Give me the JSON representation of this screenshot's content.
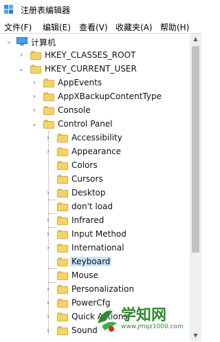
{
  "window": {
    "title": "注册表编辑器"
  },
  "menu": [
    {
      "label": "文件(F)"
    },
    {
      "label": "编辑(E)"
    },
    {
      "label": "查看(V)"
    },
    {
      "label": "收藏夹(A)"
    },
    {
      "label": "帮助(H)"
    }
  ],
  "tree": {
    "root": "计算机",
    "hkcr": "HKEY_CLASSES_ROOT",
    "hkcu": "HKEY_CURRENT_USER",
    "hkcu_children": [
      "AppEvents",
      "AppXBackupContentType",
      "Console",
      "Control Panel"
    ],
    "control_panel_children": [
      {
        "label": "Accessibility",
        "expandable": true
      },
      {
        "label": "Appearance",
        "expandable": true
      },
      {
        "label": "Colors",
        "expandable": false
      },
      {
        "label": "Cursors",
        "expandable": false
      },
      {
        "label": "Desktop",
        "expandable": true
      },
      {
        "label": "don't load",
        "expandable": false
      },
      {
        "label": "Infrared",
        "expandable": true
      },
      {
        "label": "Input Method",
        "expandable": true
      },
      {
        "label": "International",
        "expandable": true
      },
      {
        "label": "Keyboard",
        "expandable": false,
        "selected": true
      },
      {
        "label": "Mouse",
        "expandable": false
      },
      {
        "label": "Personalization",
        "expandable": true
      },
      {
        "label": "PowerCfg",
        "expandable": true
      },
      {
        "label": "Quick Actions",
        "expandable": true
      },
      {
        "label": "Sound",
        "expandable": true
      }
    ]
  },
  "watermark": {
    "text": "学知网",
    "url": "www.jmqz1000.com",
    "colors": {
      "green": "#2e8b2e",
      "red": "#d42a2a"
    }
  },
  "colors": {
    "selection": "#cce4f7",
    "folder": "#f3d36a"
  }
}
